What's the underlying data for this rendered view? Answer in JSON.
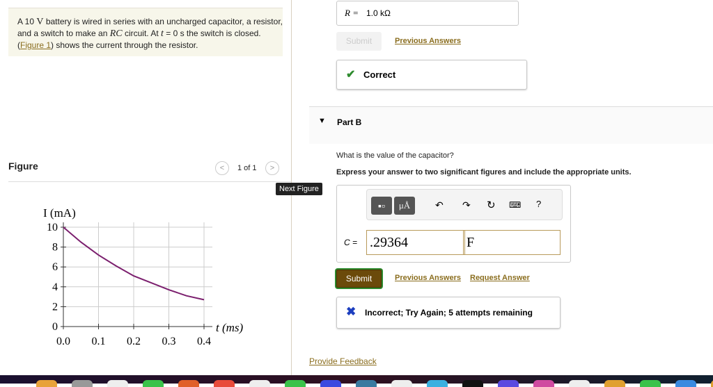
{
  "problem": {
    "text_a": "A 10 ",
    "V": "V",
    "text_b": " battery is wired in series with an uncharged capacitor, a resistor, and a switch to make an ",
    "RC": "RC",
    "text_c": " circuit. At ",
    "t": "t",
    "text_d": " = 0 s the switch is closed. (",
    "figure_link": "Figure 1",
    "text_e": ") shows the current through the resistor."
  },
  "figure": {
    "label": "Figure",
    "pager": "1 of 1",
    "prev": "<",
    "next": ">",
    "next_figure_tooltip": "Next Figure"
  },
  "chart_data": {
    "type": "line",
    "ylabel": "I (mA)",
    "xlabel": "t (ms)",
    "xlim": [
      0,
      0.4
    ],
    "ylim": [
      0,
      10
    ],
    "xticks": [
      "0.0",
      "0.1",
      "0.2",
      "0.3",
      "0.4"
    ],
    "yticks": [
      "0",
      "2",
      "4",
      "6",
      "8",
      "10"
    ],
    "series": [
      {
        "name": "I",
        "color": "#7b1f6e",
        "x": [
          0,
          0.05,
          0.1,
          0.15,
          0.2,
          0.25,
          0.3,
          0.35,
          0.4
        ],
        "y": [
          10,
          8.5,
          7.2,
          6.1,
          5.1,
          4.4,
          3.7,
          3.1,
          2.7
        ]
      }
    ]
  },
  "partA": {
    "answer_prefix": "R =",
    "answer_value": "1.0 kΩ",
    "submit": "Submit",
    "previous_answers": "Previous Answers",
    "correct": "Correct"
  },
  "partB": {
    "title": "Part B",
    "question": "What is the value of the capacitor?",
    "instruction": "Express your answer to two significant figures and include the appropriate units.",
    "toolbar": {
      "units": "μÅ",
      "help": "?"
    },
    "var_label": "C =",
    "value": ".29364",
    "unit": "F",
    "submit": "Submit",
    "previous_answers": "Previous Answers",
    "request_answer": "Request Answer",
    "feedback": "Incorrect; Try Again; 5 attempts remaining"
  },
  "provide_feedback": "Provide Feedback",
  "colors": {
    "accent": "#8a6d1e",
    "submit": "#6b4a0a",
    "correct": "#2e8b2e",
    "incorrect": "#1d3fbf",
    "curve": "#7b1f6e"
  }
}
